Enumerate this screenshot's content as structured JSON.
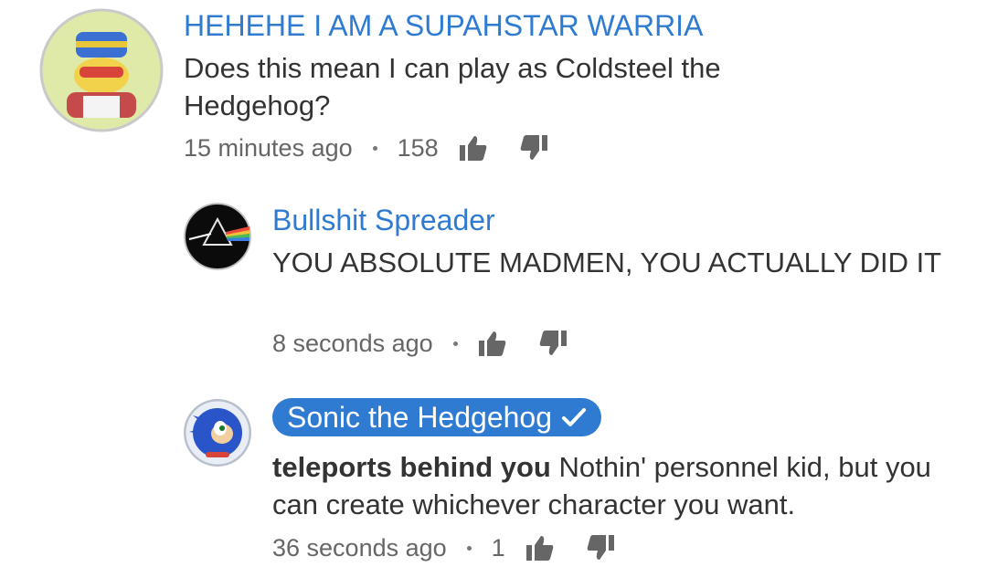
{
  "comments": [
    {
      "author": "HEHEHE I AM A SUPAHSTAR WARRIA",
      "text": "Does this mean I can play as Coldsteel the Hedgehog?",
      "time": "15 minutes ago",
      "likes": "158",
      "avatar_icon": "king-dedede-avatar-icon",
      "verified": false
    },
    {
      "author": "Bullshit Spreader",
      "text": "YOU ABSOLUTE MADMEN, YOU ACTUALLY DID IT",
      "time": "8 seconds ago",
      "likes": "",
      "avatar_icon": "prism-avatar-icon",
      "verified": false
    },
    {
      "author": "Sonic the Hedgehog",
      "text_bold": "teleports behind you",
      "text": " Nothin' personnel kid, but you can create whichever character you want.",
      "time": "36 seconds ago",
      "likes": "1",
      "avatar_icon": "sonic-avatar-icon",
      "verified": true
    }
  ],
  "colors": {
    "author_link": "#2f7bd1",
    "badge_bg": "#2f7bd1",
    "body_text": "#333333",
    "meta_text": "#666666"
  }
}
